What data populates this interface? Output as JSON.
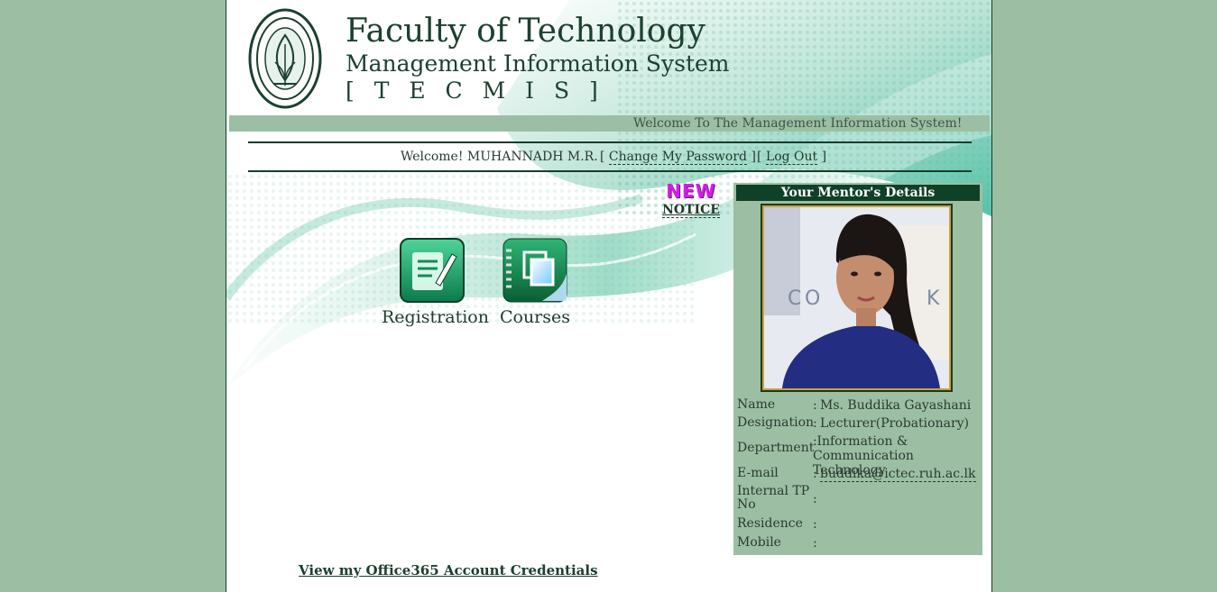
{
  "colors": {
    "outer_background": "#9cbfa3",
    "header_dark_green": "#0f4128",
    "accent_teal": "#3fb5a0",
    "new_badge": "#d21ee6"
  },
  "header": {
    "title": "Faculty of Technology",
    "subtitle": "Management Information System",
    "system_code": "[ T E C M I S ]",
    "logo_icon": "university-crest-icon"
  },
  "marquee": {
    "text": "Welcome To The Management Information System!"
  },
  "user_bar": {
    "welcome": "Welcome! MUHANNADH M.R.",
    "change_password_label": "Change My Password",
    "logout_label": "Log Out",
    "bracket_open": "[",
    "bracket_close": "]"
  },
  "notice": {
    "badge": "NEW",
    "link_label": "NOTICE"
  },
  "tiles": [
    {
      "label": "Registration",
      "icon": "registration-document-icon"
    },
    {
      "label": "Courses",
      "icon": "courses-notebook-icon"
    }
  ],
  "mentor": {
    "heading": "Your Mentor's Details",
    "photo_icon": "mentor-photo",
    "fields": [
      {
        "key": "Name",
        "value": "Ms.  Buddika Gayashani"
      },
      {
        "key": "Designation",
        "value": "Lecturer(Probationary)"
      },
      {
        "key": "Department",
        "value": "Information & Communication Technology"
      },
      {
        "key": "E-mail",
        "value": "buddika@ictec.ruh.ac.lk"
      },
      {
        "key": "Internal TP No",
        "value": ""
      },
      {
        "key": "Residence",
        "value": ""
      },
      {
        "key": "Mobile",
        "value": ""
      }
    ],
    "separator": ":"
  },
  "footer": {
    "office365_link": "View my Office365 Account Credentials"
  }
}
